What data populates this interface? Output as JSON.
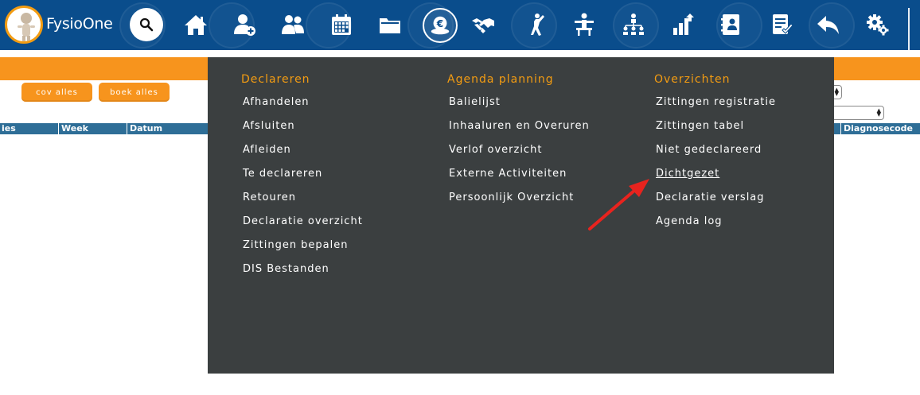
{
  "app": {
    "name": "FysioOne"
  },
  "nav": {
    "icons": [
      "search-icon",
      "home-icon",
      "add-patient-icon",
      "patients-icon",
      "calendar-icon",
      "folder-icon",
      "euro-icon",
      "handshake-icon",
      "exercise-icon",
      "therapist-icon",
      "organization-icon",
      "statistics-icon",
      "address-book-icon",
      "checklist-icon",
      "reply-icon",
      "settings-icon"
    ],
    "active": "euro-icon"
  },
  "buttons": {
    "cov_alles": "cov alles",
    "boek_alles": "boek alles"
  },
  "table": {
    "headers": [
      "ies",
      "Week",
      "Datum"
    ],
    "right_header": "Diagnosecode"
  },
  "menu": {
    "columns": [
      {
        "title": "Declareren",
        "items": [
          "Afhandelen",
          "Afsluiten",
          "Afleiden",
          "Te declareren",
          "Retouren",
          "Declaratie overzicht",
          "Zittingen bepalen",
          "DIS Bestanden"
        ]
      },
      {
        "title": "Agenda planning",
        "items": [
          "Balielijst",
          "Inhaaluren en Overuren",
          "Verlof overzicht",
          "Externe Activiteiten",
          "Persoonlijk Overzicht"
        ]
      },
      {
        "title": "Overzichten",
        "items": [
          "Zittingen registratie",
          "Zittingen tabel",
          "Niet gedeclareerd",
          "Dichtgezet",
          "Declaratie verslag",
          "Agenda log"
        ]
      }
    ],
    "highlighted": "Dichtgezet"
  },
  "colors": {
    "nav_bg": "#0a4d8c",
    "accent_orange": "#f7941d",
    "menu_bg": "#3b3f40",
    "menu_title": "#f39c12",
    "table_header": "#2e6e97",
    "annotation_arrow": "#e8231e"
  }
}
